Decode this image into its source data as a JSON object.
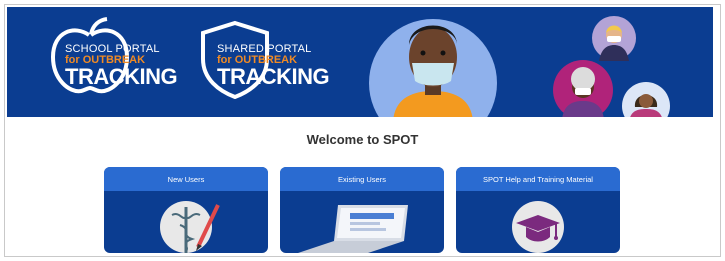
{
  "banner": {
    "school_logo": {
      "line1": "SCHOOL PORTAL",
      "line2": "for OUTBREAK",
      "line3": "TRACKING",
      "icon": "apple-outline-icon"
    },
    "shared_logo": {
      "line1": "SHARED PORTAL",
      "line2": "for OUTBREAK",
      "line3": "TRACKING",
      "icon": "shield-outline-icon"
    },
    "colors": {
      "background": "#0b3d91",
      "accent": "#f08a24"
    }
  },
  "welcome": {
    "title": "Welcome to SPOT"
  },
  "cards": [
    {
      "label": "New Users",
      "icon": "caduceus-pen-icon"
    },
    {
      "label": "Existing Users",
      "icon": "laptop-icon"
    },
    {
      "label": "SPOT Help and Training Material",
      "icon": "graduation-cap-icon"
    }
  ]
}
